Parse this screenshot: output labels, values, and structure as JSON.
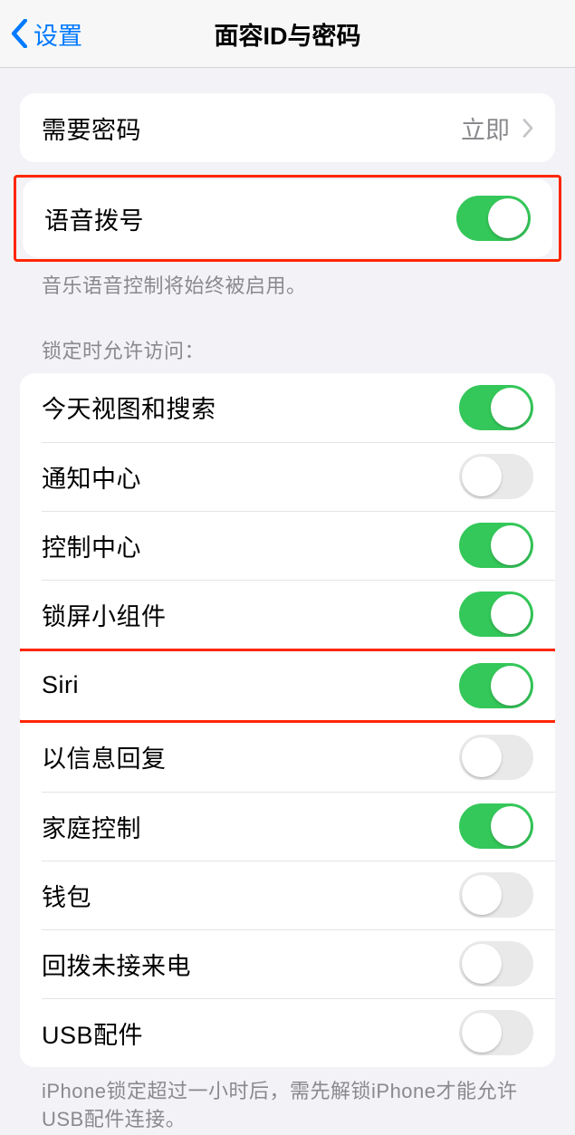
{
  "header": {
    "back_label": "设置",
    "title": "面容ID与密码"
  },
  "require_passcode": {
    "label": "需要密码",
    "value": "立即"
  },
  "voice_dial": {
    "label": "语音拨号",
    "on": true,
    "footer": "音乐语音控制将始终被启用。"
  },
  "lock_access": {
    "header": "锁定时允许访问：",
    "items": [
      {
        "label": "今天视图和搜索",
        "on": true
      },
      {
        "label": "通知中心",
        "on": false
      },
      {
        "label": "控制中心",
        "on": true
      },
      {
        "label": "锁屏小组件",
        "on": true
      },
      {
        "label": "Siri",
        "on": true
      },
      {
        "label": "以信息回复",
        "on": false
      },
      {
        "label": "家庭控制",
        "on": true
      },
      {
        "label": "钱包",
        "on": false
      },
      {
        "label": "回拨未接来电",
        "on": false
      },
      {
        "label": "USB配件",
        "on": false
      }
    ],
    "footer": "iPhone锁定超过一小时后，需先解锁iPhone才能允许USB配件连接。"
  }
}
